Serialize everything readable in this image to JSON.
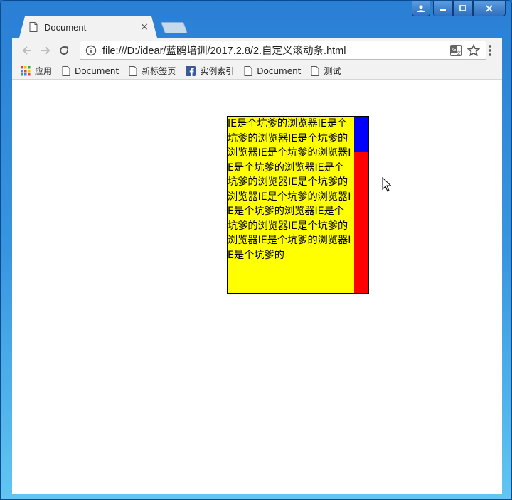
{
  "tab": {
    "title": "Document",
    "close": "×"
  },
  "address": {
    "url": "file:///D:/idear/蓝鸥培训/2017.2.8/2.自定义滚动条.html"
  },
  "bookmarks": [
    {
      "label": "应用",
      "icon": "apps-icon"
    },
    {
      "label": "Document",
      "icon": "page-icon"
    },
    {
      "label": "新标签页",
      "icon": "page-icon"
    },
    {
      "label": "实例索引",
      "icon": "facebook-icon"
    },
    {
      "label": "Document",
      "icon": "page-icon"
    },
    {
      "label": "测试",
      "icon": "page-icon"
    }
  ],
  "content": {
    "text": "IE是个坑爹的浏览器IE是个坑爹的浏览器IE是个坑爹的浏览器IE是个坑爹的浏览器IE是个坑爹的浏览器IE是个坑爹的浏览器IE是个坑爹的浏览器IE是个坑爹的浏览器IE是个坑爹的浏览器IE是个坑爹的浏览器IE是个坑爹的浏览器IE是个坑爹的浏览器IE是个坑爹的"
  },
  "colors": {
    "box_background": "#ffff00",
    "scroll_track": "#ff0000",
    "scroll_thumb": "#0000ff"
  }
}
